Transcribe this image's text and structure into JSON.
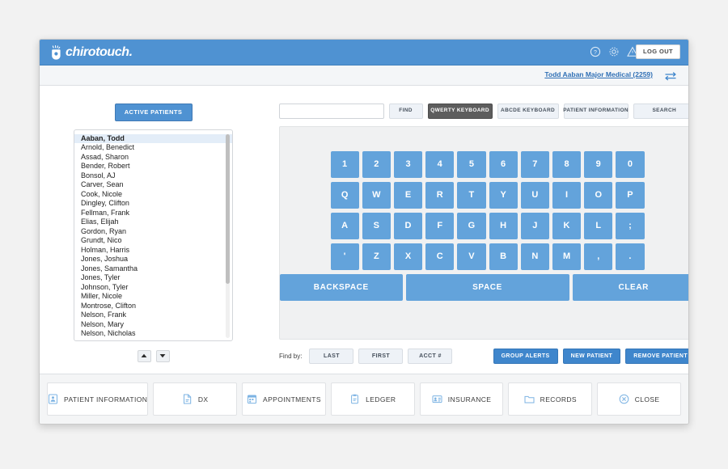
{
  "app": {
    "logo_text": "chirotouch.",
    "logout_label": "LOG OUT",
    "header_icons": [
      "help-icon",
      "gear-icon",
      "warning-icon"
    ]
  },
  "subheader": {
    "patient_link": "Todd Aaban  Major Medical (2259)",
    "swap_icon": "swap-arrows-icon"
  },
  "left_panel": {
    "active_patients_label": "ACTIVE PATIENTS",
    "selected_index": 0,
    "patients": [
      "Aaban, Todd",
      "Arnold, Benedict",
      "Assad, Sharon",
      "Bender, Robert",
      "Bonsol, AJ",
      "Carver, Sean",
      "Cook, Nicole",
      "Dingley, Clifton",
      "Fellman, Frank",
      "Elias, Elijah",
      "Gordon, Ryan",
      "Grundt, Nico",
      "Holman, Harris",
      "Jones, Joshua",
      "Jones, Samantha",
      "Jones, Tyler",
      "Johnson, Tyler",
      "Miller, Nicole",
      "Montrose, Clifton",
      "Nelson, Frank",
      "Nelson, Mary",
      "Nelson, Nicholas"
    ],
    "scroll_up_icon": "chevron-up-icon",
    "scroll_down_icon": "chevron-down-icon"
  },
  "toolbar": {
    "search_value": "",
    "search_placeholder": "",
    "find_label": "FIND",
    "qwerty_label": "QWERTY KEYBOARD",
    "abcde_label": "ABCDE KEYBOARD",
    "patient_information_label": "PATIENT INFORMATION",
    "search_label": "SEARCH",
    "active_button": "QWERTY KEYBOARD"
  },
  "keyboard": {
    "layout": "qwerty",
    "rows": [
      [
        "1",
        "2",
        "3",
        "4",
        "5",
        "6",
        "7",
        "8",
        "9",
        "0"
      ],
      [
        "Q",
        "W",
        "E",
        "R",
        "T",
        "Y",
        "U",
        "I",
        "O",
        "P"
      ],
      [
        "A",
        "S",
        "D",
        "F",
        "G",
        "H",
        "J",
        "K",
        "L",
        ";"
      ],
      [
        "'",
        "Z",
        "X",
        "C",
        "V",
        "B",
        "N",
        "M",
        ",",
        "."
      ]
    ],
    "backspace_label": "BACKSPACE",
    "space_label": "SPACE",
    "clear_label": "CLEAR",
    "key_color": "#63a3db"
  },
  "findby": {
    "label": "Find by:",
    "buttons": [
      "LAST",
      "FIRST",
      "ACCT #"
    ],
    "actions": [
      "GROUP ALERTS",
      "NEW PATIENT",
      "REMOVE PATIENT"
    ]
  },
  "bottom_nav": [
    {
      "label": "PATIENT INFORMATION",
      "icon": "patient-card-icon"
    },
    {
      "label": "DX",
      "icon": "document-icon"
    },
    {
      "label": "APPOINTMENTS",
      "icon": "calendar-icon"
    },
    {
      "label": "LEDGER",
      "icon": "clipboard-icon"
    },
    {
      "label": "INSURANCE",
      "icon": "insurance-card-icon"
    },
    {
      "label": "RECORDS",
      "icon": "folder-icon"
    },
    {
      "label": "CLOSE",
      "icon": "close-circle-icon"
    }
  ],
  "colors": {
    "brand_blue": "#4f92d2",
    "key_blue": "#63a3db",
    "action_blue": "#3f86cc",
    "page_bg": "#f2f2f2"
  }
}
